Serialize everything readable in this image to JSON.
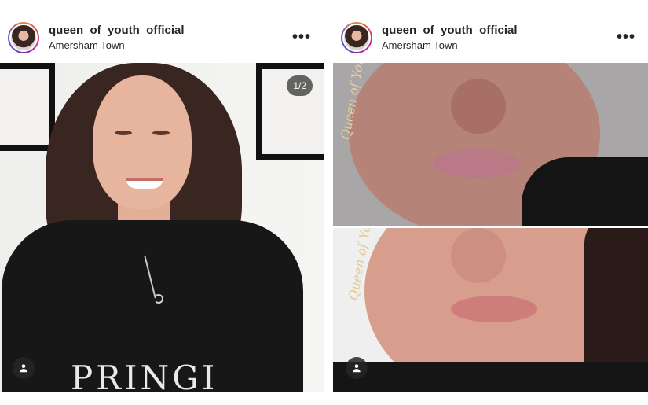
{
  "posts": [
    {
      "username": "queen_of_youth_official",
      "location": "Amersham Town",
      "more_icon": "more-horizontal-icon",
      "slide_counter": "1/2",
      "shirt_text": "PRINGI",
      "tag_icon": "user-tag-icon"
    },
    {
      "username": "queen_of_youth_official",
      "location": "Amersham Town",
      "more_icon": "more-horizontal-icon",
      "watermark_top": "Queen of Youth",
      "watermark_bottom": "Queen of Youth",
      "tag_icon": "user-tag-icon"
    }
  ],
  "colors": {
    "text_primary": "#262626",
    "story_ring": [
      "#f58529",
      "#dd2a7b",
      "#8134af",
      "#515bd4"
    ]
  }
}
